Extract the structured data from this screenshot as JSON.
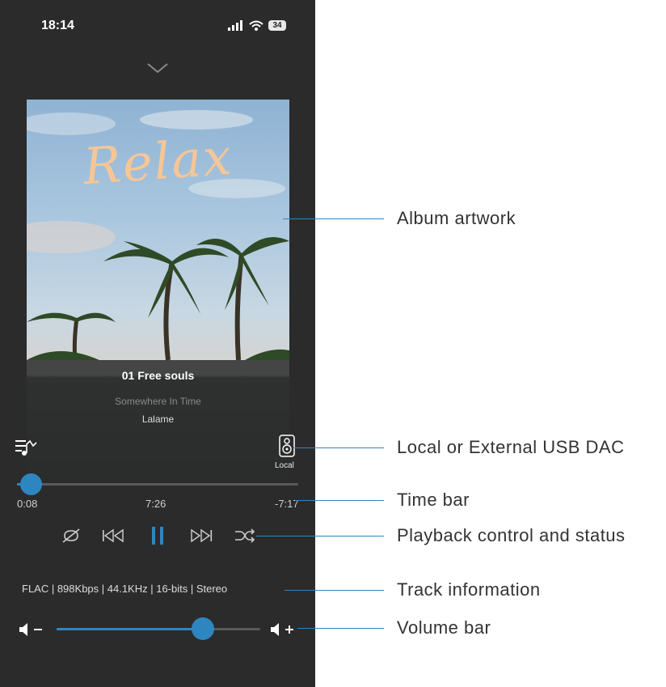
{
  "status": {
    "time": "18:14",
    "battery": "34"
  },
  "album": {
    "art_text": "Relax"
  },
  "track": {
    "title": "01 Free souls",
    "album": "Somewhere In Time",
    "artist": "Lalame"
  },
  "output": {
    "label": "Local"
  },
  "progress": {
    "elapsed": "0:08",
    "total": "7:26",
    "remaining": "-7:17",
    "fraction": 0.05
  },
  "track_info": "FLAC | 898Kbps | 44.1KHz | 16-bits | Stereo",
  "volume": {
    "fraction": 0.72
  },
  "annotations": {
    "album_artwork": "Album artwork",
    "dac": "Local or External USB DAC",
    "time_bar": "Time bar",
    "playback": "Playback control and status",
    "track_information": "Track information",
    "volume_bar": "Volume bar"
  },
  "colors": {
    "accent": "#2e86c1",
    "background": "#2b2b2b",
    "art_text": "#f6c695"
  },
  "icons": [
    "signal-icon",
    "wifi-icon",
    "battery-icon",
    "chevron-down-icon",
    "queue-icon",
    "speaker-icon",
    "loop-off-icon",
    "previous-icon",
    "pause-icon",
    "next-icon",
    "shuffle-icon",
    "volume-down-icon",
    "volume-up-icon"
  ]
}
